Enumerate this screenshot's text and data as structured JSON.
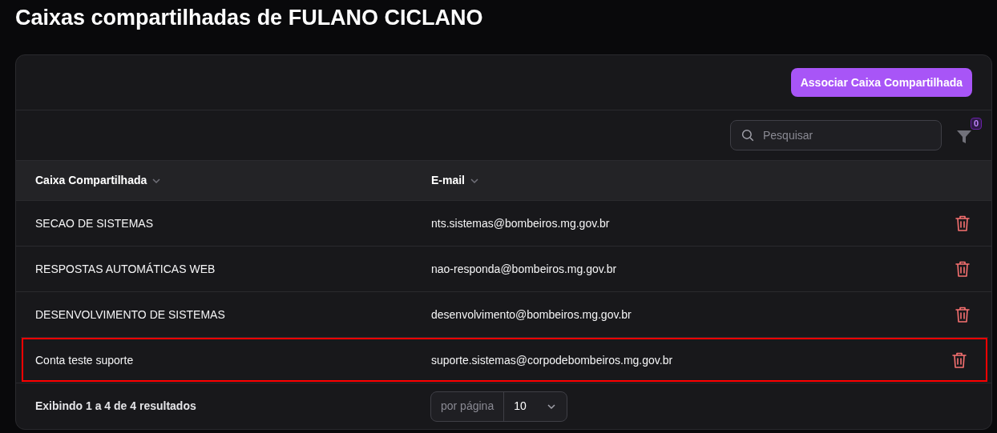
{
  "title": "Caixas compartilhadas de FULANO CICLANO",
  "action_button": "Associar Caixa Compartilhada",
  "search": {
    "placeholder": "Pesquisar"
  },
  "filter": {
    "count": "0"
  },
  "table": {
    "columns": [
      "Caixa Compartilhada",
      "E-mail"
    ],
    "rows": [
      {
        "name": "SECAO DE SISTEMAS",
        "email": "nts.sistemas@bombeiros.mg.gov.br",
        "highlighted": false
      },
      {
        "name": "RESPOSTAS AUTOMÁTICAS WEB",
        "email": "nao-responda@bombeiros.mg.gov.br",
        "highlighted": false
      },
      {
        "name": "DESENVOLVIMENTO DE SISTEMAS",
        "email": "desenvolvimento@bombeiros.mg.gov.br",
        "highlighted": false
      },
      {
        "name": "Conta teste suporte",
        "email": "suporte.sistemas@corpodebombeiros.mg.gov.br",
        "highlighted": true
      }
    ]
  },
  "footer": {
    "summary": "Exibindo 1 a 4 de 4 resultados",
    "per_page_label": "por página",
    "per_page_value": "10"
  }
}
